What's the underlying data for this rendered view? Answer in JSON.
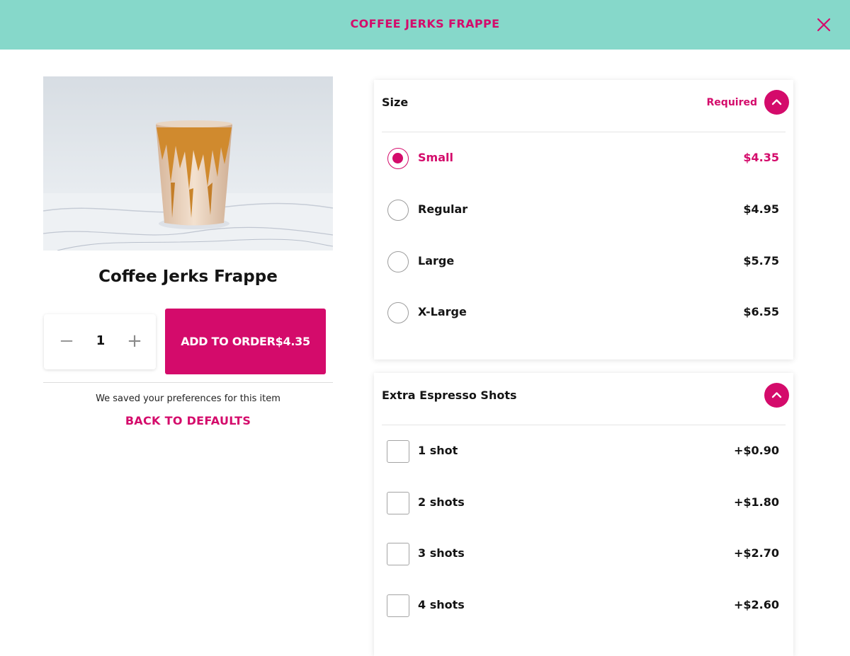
{
  "header": {
    "title": "COFFEE JERKS FRAPPE",
    "close_icon": "close-icon"
  },
  "product": {
    "name": "Coffee Jerks Frappe",
    "image_icon": "frappe-photo"
  },
  "quantity": {
    "value": "1",
    "minus": "−",
    "plus": "+"
  },
  "add_button": {
    "label": "ADD TO ORDER",
    "price": "$4.35"
  },
  "saved_note": "We saved your preferences for this item",
  "back_to_defaults": "BACK TO DEFAULTS",
  "size_section": {
    "title": "Size",
    "required": "Required",
    "options": [
      {
        "label": "Small",
        "price": "$4.35",
        "selected": true
      },
      {
        "label": "Regular",
        "price": "$4.95",
        "selected": false
      },
      {
        "label": "Large",
        "price": "$5.75",
        "selected": false
      },
      {
        "label": "X-Large",
        "price": "$6.55",
        "selected": false
      }
    ]
  },
  "shots_section": {
    "title": "Extra Espresso Shots",
    "options": [
      {
        "label": "1 shot",
        "price": "+$0.90"
      },
      {
        "label": "2 shots",
        "price": "+$1.80"
      },
      {
        "label": "3 shots",
        "price": "+$2.70"
      },
      {
        "label": "4 shots",
        "price": "+$2.60"
      }
    ]
  },
  "colors": {
    "accent": "#d40b6b",
    "header_bg": "#86d8ca"
  }
}
